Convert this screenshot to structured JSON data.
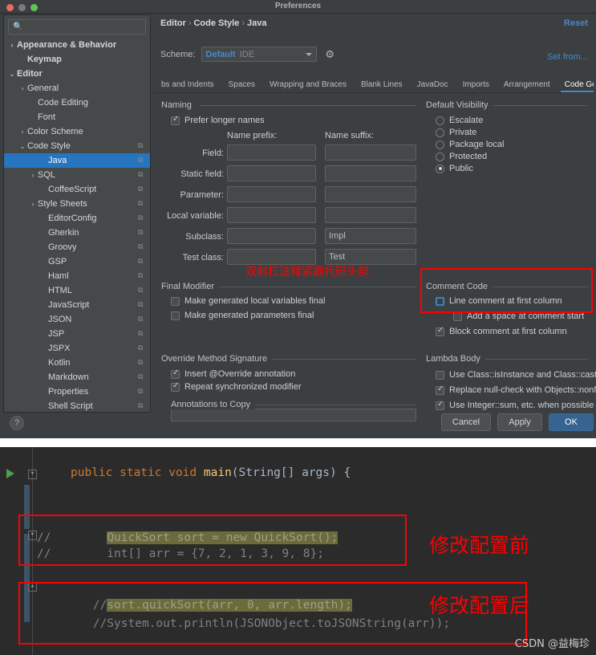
{
  "window": {
    "title": "Preferences",
    "traffic_lights": [
      "close-button",
      "minimize-button",
      "zoom-button"
    ]
  },
  "sidebar": {
    "search": {
      "value": "",
      "placeholder": "",
      "icon": "search-icon"
    },
    "items": [
      {
        "label": "Appearance & Behavior",
        "twisty": "›",
        "indent": 0,
        "bold": true,
        "selected": false,
        "copy": false
      },
      {
        "label": "Keymap",
        "twisty": "",
        "indent": 1,
        "bold": true,
        "selected": false,
        "copy": false
      },
      {
        "label": "Editor",
        "twisty": "⌄",
        "indent": 0,
        "bold": true,
        "selected": false,
        "copy": false
      },
      {
        "label": "General",
        "twisty": "›",
        "indent": 1,
        "bold": false,
        "selected": false,
        "copy": false
      },
      {
        "label": "Code Editing",
        "twisty": "",
        "indent": 2,
        "bold": false,
        "selected": false,
        "copy": false
      },
      {
        "label": "Font",
        "twisty": "",
        "indent": 2,
        "bold": false,
        "selected": false,
        "copy": false
      },
      {
        "label": "Color Scheme",
        "twisty": "›",
        "indent": 1,
        "bold": false,
        "selected": false,
        "copy": false
      },
      {
        "label": "Code Style",
        "twisty": "⌄",
        "indent": 1,
        "bold": false,
        "selected": false,
        "copy": true
      },
      {
        "label": "Java",
        "twisty": "",
        "indent": 3,
        "bold": false,
        "selected": true,
        "copy": true
      },
      {
        "label": "SQL",
        "twisty": "›",
        "indent": 2,
        "bold": false,
        "selected": false,
        "copy": true
      },
      {
        "label": "CoffeeScript",
        "twisty": "",
        "indent": 3,
        "bold": false,
        "selected": false,
        "copy": true
      },
      {
        "label": "Style Sheets",
        "twisty": "›",
        "indent": 2,
        "bold": false,
        "selected": false,
        "copy": true
      },
      {
        "label": "EditorConfig",
        "twisty": "",
        "indent": 3,
        "bold": false,
        "selected": false,
        "copy": true
      },
      {
        "label": "Gherkin",
        "twisty": "",
        "indent": 3,
        "bold": false,
        "selected": false,
        "copy": true
      },
      {
        "label": "Groovy",
        "twisty": "",
        "indent": 3,
        "bold": false,
        "selected": false,
        "copy": true
      },
      {
        "label": "GSP",
        "twisty": "",
        "indent": 3,
        "bold": false,
        "selected": false,
        "copy": true
      },
      {
        "label": "Haml",
        "twisty": "",
        "indent": 3,
        "bold": false,
        "selected": false,
        "copy": true
      },
      {
        "label": "HTML",
        "twisty": "",
        "indent": 3,
        "bold": false,
        "selected": false,
        "copy": true
      },
      {
        "label": "JavaScript",
        "twisty": "",
        "indent": 3,
        "bold": false,
        "selected": false,
        "copy": true
      },
      {
        "label": "JSON",
        "twisty": "",
        "indent": 3,
        "bold": false,
        "selected": false,
        "copy": true
      },
      {
        "label": "JSP",
        "twisty": "",
        "indent": 3,
        "bold": false,
        "selected": false,
        "copy": true
      },
      {
        "label": "JSPX",
        "twisty": "",
        "indent": 3,
        "bold": false,
        "selected": false,
        "copy": true
      },
      {
        "label": "Kotlin",
        "twisty": "",
        "indent": 3,
        "bold": false,
        "selected": false,
        "copy": true
      },
      {
        "label": "Markdown",
        "twisty": "",
        "indent": 3,
        "bold": false,
        "selected": false,
        "copy": true
      },
      {
        "label": "Properties",
        "twisty": "",
        "indent": 3,
        "bold": false,
        "selected": false,
        "copy": true
      },
      {
        "label": "Shell Script",
        "twisty": "",
        "indent": 3,
        "bold": false,
        "selected": false,
        "copy": true
      }
    ],
    "help_label": "?"
  },
  "header": {
    "breadcrumb": [
      "Editor",
      "Code Style",
      "Java"
    ],
    "separator": "›",
    "reset_label": "Reset",
    "scheme_label": "Scheme:",
    "scheme_value": "Default",
    "scheme_sub": "IDE",
    "gear_icon": "gear-icon",
    "set_from_label": "Set from..."
  },
  "tabs": {
    "items": [
      "bs and Indents",
      "Spaces",
      "Wrapping and Braces",
      "Blank Lines",
      "JavaDoc",
      "Imports",
      "Arrangement",
      "Code Generation"
    ],
    "active": "Code Generation",
    "overflow_icon": "chevron-down-icon"
  },
  "naming": {
    "title": "Naming",
    "prefer_longer": {
      "label": "Prefer longer names",
      "checked": true
    },
    "col_prefix": "Name prefix:",
    "col_suffix": "Name suffix:",
    "rows": [
      {
        "label": "Field:",
        "prefix": "",
        "suffix": ""
      },
      {
        "label": "Static field:",
        "prefix": "",
        "suffix": ""
      },
      {
        "label": "Parameter:",
        "prefix": "",
        "suffix": ""
      },
      {
        "label": "Local variable:",
        "prefix": "",
        "suffix": ""
      },
      {
        "label": "Subclass:",
        "prefix": "",
        "suffix": "Impl"
      },
      {
        "label": "Test class:",
        "prefix": "",
        "suffix": "Test"
      }
    ]
  },
  "default_visibility": {
    "title": "Default Visibility",
    "options": [
      {
        "label": "Escalate",
        "selected": false
      },
      {
        "label": "Private",
        "selected": false
      },
      {
        "label": "Package local",
        "selected": false
      },
      {
        "label": "Protected",
        "selected": false
      },
      {
        "label": "Public",
        "selected": true
      }
    ]
  },
  "final_modifier": {
    "title": "Final Modifier",
    "options": [
      {
        "label": "Make generated local variables final",
        "checked": false
      },
      {
        "label": "Make generated parameters final",
        "checked": false
      }
    ]
  },
  "comment_code": {
    "title": "Comment Code",
    "options": [
      {
        "label": "Line comment at first column",
        "checked": false,
        "highlight": true,
        "indent": 0
      },
      {
        "label": "Add a space at comment start",
        "checked": false,
        "highlight": false,
        "indent": 1
      },
      {
        "label": "Block comment at first column",
        "checked": true,
        "highlight": false,
        "indent": 0
      }
    ]
  },
  "override_method_signature": {
    "title": "Override Method Signature",
    "options": [
      {
        "label": "Insert @Override annotation",
        "checked": true
      },
      {
        "label": "Repeat synchronized modifier",
        "checked": true
      }
    ],
    "annotations_title": "Annotations to Copy",
    "annotations_value": ""
  },
  "lambda_body": {
    "title": "Lambda Body",
    "options": [
      {
        "label": "Use Class::isInstance and Class::cast",
        "checked": false
      },
      {
        "label": "Replace null-check with Objects::nonN",
        "checked": true
      },
      {
        "label": "Use Integer::sum, etc. when possible",
        "checked": true
      }
    ]
  },
  "buttons": {
    "cancel": "Cancel",
    "apply": "Apply",
    "ok": "OK"
  },
  "annotations": {
    "prefs_note": "双斜杠注释紧跟代码头部",
    "before_note": "修改配置前",
    "after_note": "修改配置后",
    "accent_red": "#fe0000",
    "accent_blue": "#4a88c7"
  },
  "editor": {
    "run_icon": "run-arrow-icon",
    "lines": [
      {
        "id": "signature",
        "segments": [
          {
            "text": "public ",
            "style": "kw"
          },
          {
            "text": "static ",
            "style": "kw"
          },
          {
            "text": "void ",
            "style": "kw"
          },
          {
            "text": "main",
            "style": "fn"
          },
          {
            "text": "(String[] args) {",
            "style": "pl"
          }
        ]
      },
      {
        "id": "before-1",
        "segments": [
          {
            "text": "//",
            "style": "cmt"
          },
          {
            "text": "        ",
            "style": "cmt"
          },
          {
            "text": "QuickSort sort = new QuickSort();",
            "style": "cmt-hl"
          }
        ]
      },
      {
        "id": "before-2",
        "segments": [
          {
            "text": "//",
            "style": "cmt"
          },
          {
            "text": "        int[] arr = {7, 2, 1, 3, 9, 8};",
            "style": "cmt"
          }
        ]
      },
      {
        "id": "after-1",
        "segments": [
          {
            "text": "        //",
            "style": "cmt"
          },
          {
            "text": "sort.quickSort(arr, 0, arr.length);",
            "style": "cmt-hl"
          }
        ]
      },
      {
        "id": "after-2",
        "segments": [
          {
            "text": "        //System.out.println(JSONObject.toJSONString(arr));",
            "style": "cmt"
          }
        ]
      }
    ],
    "watermark": "CSDN @益梅珍"
  }
}
